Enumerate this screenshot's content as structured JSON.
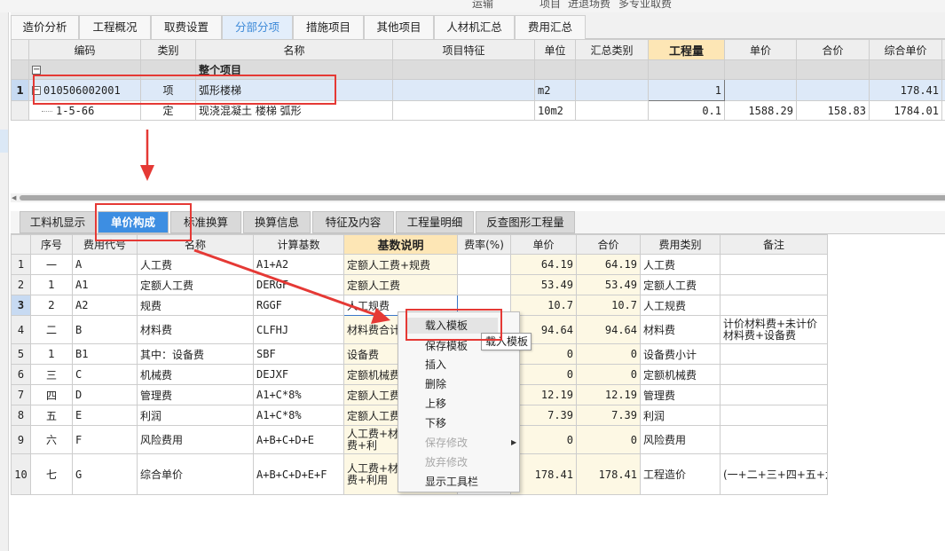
{
  "top_strip": [
    "运输",
    "项目",
    "进退场费",
    "多专业取费"
  ],
  "top_tabs": [
    "造价分析",
    "工程概况",
    "取费设置",
    "分部分项",
    "措施项目",
    "其他项目",
    "人材机汇总",
    "费用汇总"
  ],
  "top_active_tab": "分部分项",
  "item_grid": {
    "headers": [
      "编码",
      "类别",
      "名称",
      "项目特征",
      "单位",
      "汇总类别",
      "工程量",
      "单价",
      "合价",
      "综合单价",
      "综"
    ],
    "group_label": "整个项目",
    "rows": [
      {
        "row_no": "1",
        "code": "010506002001",
        "type": "项",
        "name": "弧形楼梯",
        "feature": "",
        "unit": "m2",
        "summary": "",
        "qty": "1",
        "price": "",
        "total": "",
        "comp_price": "178.41"
      },
      {
        "row_no": "",
        "code": "1-5-66",
        "type": "定",
        "name": "现浇混凝土 楼梯 弧形",
        "feature": "",
        "unit": "10m2",
        "summary": "",
        "qty": "0.1",
        "price": "1588.29",
        "total": "158.83",
        "comp_price": "1784.01"
      }
    ]
  },
  "bottom_tabs": [
    "工料机显示",
    "单价构成",
    "标准换算",
    "换算信息",
    "特征及内容",
    "工程量明细",
    "反查图形工程量"
  ],
  "bottom_active_tab": "单价构成",
  "cost_grid": {
    "headers": [
      "序号",
      "费用代号",
      "名称",
      "计算基数",
      "基数说明",
      "费率(%)",
      "单价",
      "合价",
      "费用类别",
      "备注"
    ],
    "rows": [
      {
        "row_no": "1",
        "seq": "一",
        "code": "A",
        "name": "人工费",
        "base": "A1+A2",
        "desc": "定额人工费+规费",
        "rate": "",
        "price": "64.19",
        "total": "64.19",
        "cat": "人工费",
        "note": ""
      },
      {
        "row_no": "2",
        "seq": "1",
        "code": "A1",
        "name": "定额人工费",
        "base": "DERGF",
        "desc": "定额人工费",
        "rate": "",
        "price": "53.49",
        "total": "53.49",
        "cat": "定额人工费",
        "note": ""
      },
      {
        "row_no": "3",
        "seq": "2",
        "code": "A2",
        "name": "规费",
        "base": "RGGF",
        "desc": "人工规费",
        "rate": "",
        "price": "10.7",
        "total": "10.7",
        "cat": "人工规费",
        "note": ""
      },
      {
        "row_no": "4",
        "seq": "二",
        "code": "B",
        "name": "材料费",
        "base": "CLFHJ",
        "desc": "材料费合计",
        "rate": "",
        "price": "94.64",
        "total": "94.64",
        "cat": "材料费",
        "note": "计价材料费+未计价材料费+设备费"
      },
      {
        "row_no": "5",
        "seq": "1",
        "code": "B1",
        "name": "其中：设备费",
        "base": "SBF",
        "desc": "设备费",
        "rate": "",
        "price": "0",
        "total": "0",
        "cat": "设备费小计",
        "note": ""
      },
      {
        "row_no": "6",
        "seq": "三",
        "code": "C",
        "name": "机械费",
        "base": "DEJXF",
        "desc": "定额机械费",
        "rate": "",
        "price": "0",
        "total": "0",
        "cat": "定额机械费",
        "note": ""
      },
      {
        "row_no": "7",
        "seq": "四",
        "code": "D",
        "name": "管理费",
        "base": "A1+C*8%",
        "desc": "定额人工费",
        "rate": "",
        "price": "12.19",
        "total": "12.19",
        "cat": "管理费",
        "note": ""
      },
      {
        "row_no": "8",
        "seq": "五",
        "code": "E",
        "name": "利润",
        "base": "A1+C*8%",
        "desc": "定额人工费",
        "rate": "",
        "price": "7.39",
        "total": "7.39",
        "cat": "利润",
        "note": ""
      },
      {
        "row_no": "9",
        "seq": "六",
        "code": "F",
        "name": "风险费用",
        "base": "A+B+C+D+E",
        "desc": "人工费+材料费+管理费+利",
        "rate": "",
        "price": "0",
        "total": "0",
        "cat": "风险费用",
        "note": ""
      },
      {
        "row_no": "10",
        "seq": "七",
        "code": "G",
        "name": "综合单价",
        "base": "A+B+C+D+E+F",
        "desc": "人工费+材料费+管理费+利用",
        "rate": "",
        "price": "178.41",
        "total": "178.41",
        "cat": "工程造价",
        "note": "(一+二+三+四+五+六)"
      }
    ]
  },
  "context_menu": [
    {
      "label": "载入模板",
      "disabled": false
    },
    {
      "label": "保存模板",
      "disabled": false
    },
    {
      "label": "插入",
      "disabled": false
    },
    {
      "label": "删除",
      "disabled": false
    },
    {
      "label": "上移",
      "disabled": false
    },
    {
      "label": "下移",
      "disabled": false
    },
    {
      "label": "保存修改",
      "disabled": true
    },
    {
      "label": "放弃修改",
      "disabled": true
    },
    {
      "label": "显示工具栏",
      "disabled": false
    }
  ],
  "tooltip": "载入模板",
  "colors": {
    "accent": "#3d8ee2",
    "highlight_header": "#fde6b5",
    "annotation": "#e53935",
    "selected_row": "#dde9f8"
  }
}
